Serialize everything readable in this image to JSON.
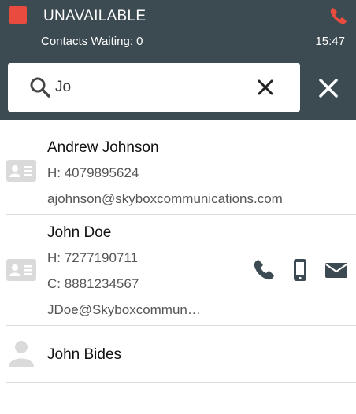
{
  "header": {
    "status": "UNAVAILABLE",
    "status_color": "#ea4b3f",
    "contacts_waiting": "Contacts Waiting: 0",
    "time": "15:47",
    "end_call_icon": "phone-hangup-icon"
  },
  "search": {
    "value": "Jo",
    "icon": "search-icon",
    "clear_icon": "close-icon"
  },
  "contacts": [
    {
      "name": "Andrew Johnson",
      "home": "H: 4079895624",
      "email": "ajohnson@skyboxcommunications.com",
      "icon": "contact-card-icon"
    },
    {
      "name": "John Doe",
      "home": "H: 7277190711",
      "cell": "C: 8881234567",
      "email": "JDoe@Skyboxcommun…",
      "icon": "contact-card-icon",
      "actions": [
        "phone-icon",
        "mobile-icon",
        "email-icon"
      ]
    },
    {
      "name": "John Bides",
      "icon": "person-icon"
    }
  ],
  "colors": {
    "header_bg": "#3c4a52",
    "icon_gray": "#dadada",
    "action_color": "#3c4a52",
    "accent_red": "#ea4b3f"
  }
}
